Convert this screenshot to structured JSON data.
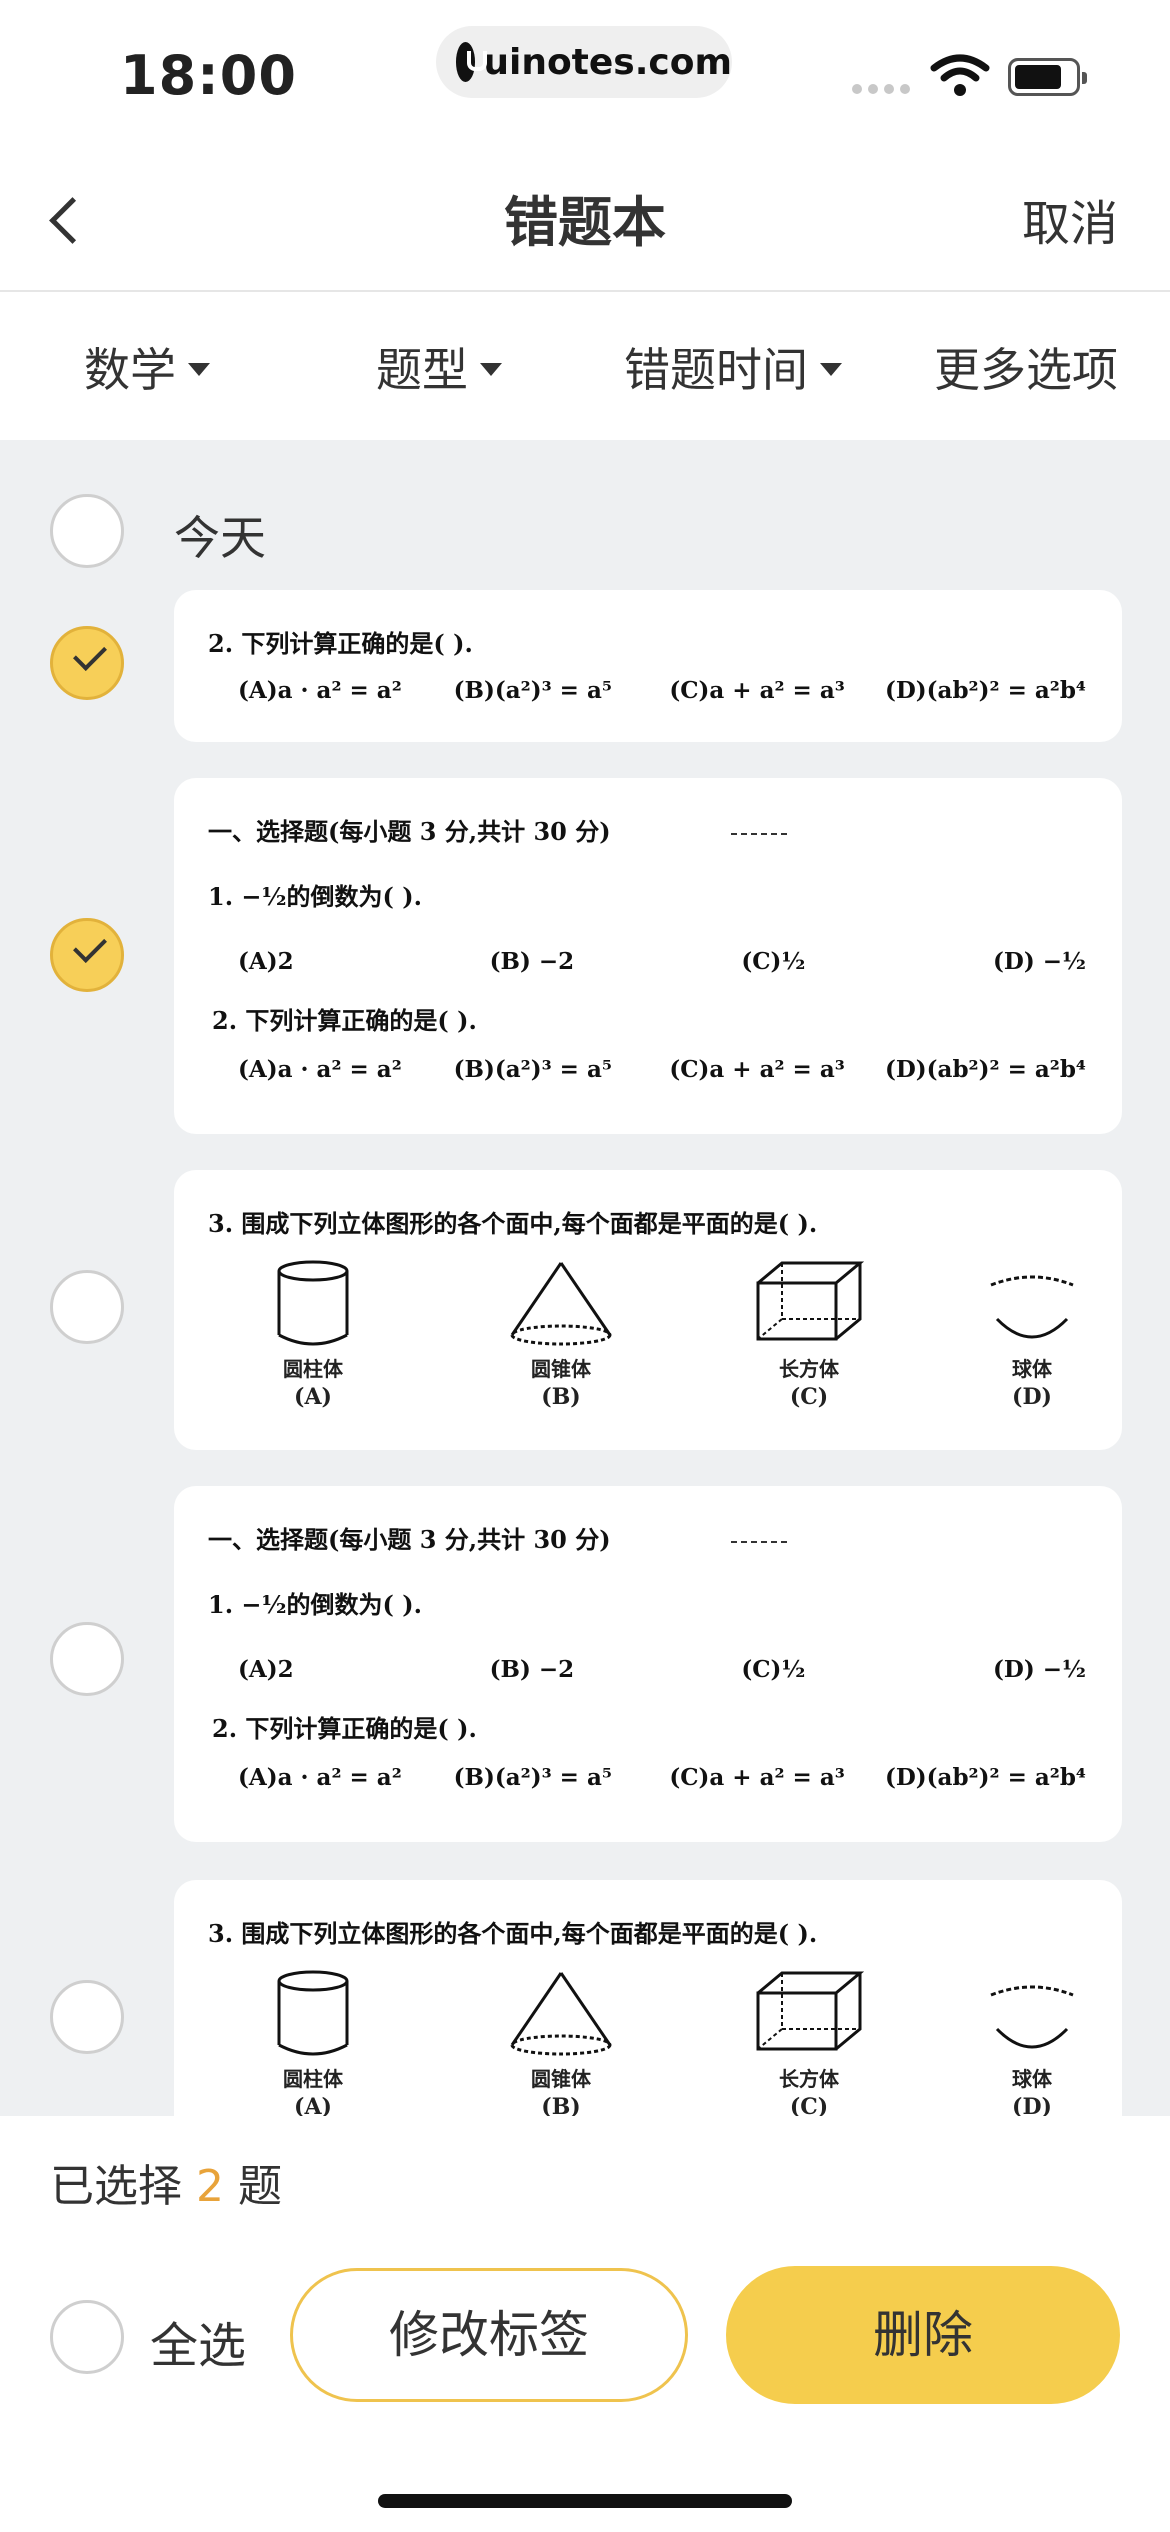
{
  "status_bar": {
    "time": "18:00",
    "url": "uinotes.com",
    "icons": [
      "cellular-signal-icon",
      "wifi-icon",
      "battery-icon"
    ]
  },
  "nav": {
    "title": "错题本",
    "cancel_label": "取消",
    "back_icon": "chevron-left-icon"
  },
  "filters": [
    {
      "label": "数学",
      "has_caret": true
    },
    {
      "label": "题型",
      "has_caret": true
    },
    {
      "label": "错题时间",
      "has_caret": true
    },
    {
      "label": "更多选项",
      "has_caret": false
    }
  ],
  "list": {
    "group_label": "今天",
    "items": [
      {
        "checked": true,
        "q2": {
          "question": "2. 下列计算正确的是(        ).",
          "options": [
            "(A)a · a² = a²",
            "(B)(a²)³ = a⁵",
            "(C)a + a² = a³",
            "(D)(ab²)² = a²b⁴"
          ]
        }
      },
      {
        "checked": true,
        "section": "一、选择题(每小题 3 分,共计 30 分)",
        "q1": {
          "question": "1. −½的倒数为(        ).",
          "options": [
            "(A)2",
            "(B) −2",
            "(C)½",
            "(D) −½"
          ]
        },
        "q2": {
          "question": "2. 下列计算正确的是(        ).",
          "options": [
            "(A)a · a² = a²",
            "(B)(a²)³ = a⁵",
            "(C)a + a² = a³",
            "(D)(ab²)² = a²b⁴"
          ]
        }
      },
      {
        "checked": false,
        "q3": {
          "question": "3. 围成下列立体图形的各个面中,每个面都是平面的是(        ).",
          "shapes": [
            {
              "name": "圆柱体",
              "tag": "(A)"
            },
            {
              "name": "圆锥体",
              "tag": "(B)"
            },
            {
              "name": "长方体",
              "tag": "(C)"
            },
            {
              "name": "球体",
              "tag": "(D)"
            }
          ]
        }
      },
      {
        "checked": false,
        "section": "一、选择题(每小题 3 分,共计 30 分)",
        "q1": {
          "question": "1. −½的倒数为(        ).",
          "options": [
            "(A)2",
            "(B) −2",
            "(C)½",
            "(D) −½"
          ]
        },
        "q2": {
          "question": "2. 下列计算正确的是(        ).",
          "options": [
            "(A)a · a² = a²",
            "(B)(a²)³ = a⁵",
            "(C)a + a² = a³",
            "(D)(ab²)² = a²b⁴"
          ]
        }
      },
      {
        "checked": false,
        "q3": {
          "question": "3. 围成下列立体图形的各个面中,每个面都是平面的是(        ).",
          "shapes": [
            {
              "name": "圆柱体",
              "tag": "(A)"
            },
            {
              "name": "圆锥体",
              "tag": "(B)"
            },
            {
              "name": "长方体",
              "tag": "(C)"
            },
            {
              "name": "球体",
              "tag": "(D)"
            }
          ]
        }
      }
    ]
  },
  "bottom": {
    "selected_prefix": "已选择",
    "selected_count": "2",
    "selected_suffix": "题",
    "select_all_label": "全选",
    "edit_tag_label": "修改标签",
    "delete_label": "删除"
  },
  "colors": {
    "accent": "#f5cd4d",
    "count_highlight": "#e8a33a",
    "list_background": "#eef0f2"
  }
}
